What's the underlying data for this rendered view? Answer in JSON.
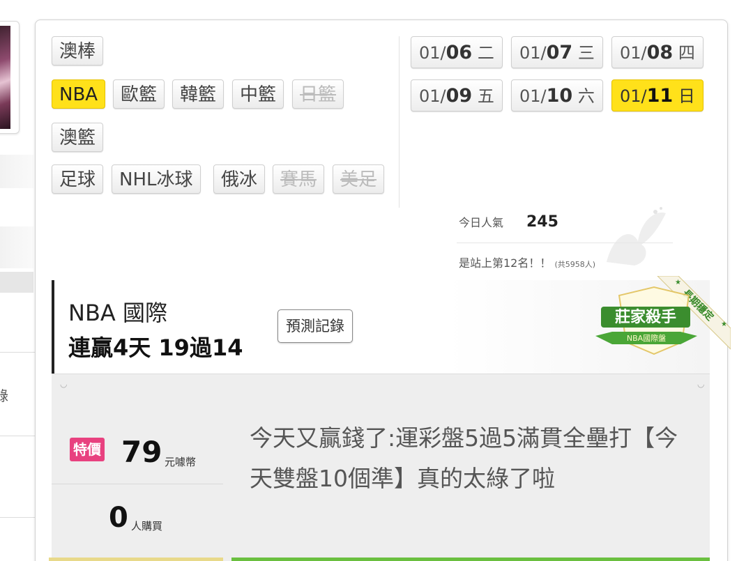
{
  "categories": {
    "row1": [
      {
        "label": "澳棒",
        "state": "normal"
      }
    ],
    "row2": [
      {
        "label": "NBA",
        "state": "active"
      },
      {
        "label": "歐籃",
        "state": "normal"
      },
      {
        "label": "韓籃",
        "state": "normal"
      },
      {
        "label": "中籃",
        "state": "normal"
      },
      {
        "label": "日籃",
        "state": "disabled"
      }
    ],
    "row3": [
      {
        "label": "澳籃",
        "state": "normal"
      }
    ],
    "row4": [
      {
        "label": "足球",
        "state": "normal"
      },
      {
        "label": "NHL冰球",
        "state": "normal"
      },
      {
        "label": "俄冰",
        "state": "normal"
      },
      {
        "label": "賽馬",
        "state": "disabled"
      },
      {
        "label": "美足",
        "state": "disabled"
      }
    ]
  },
  "dates": [
    {
      "month": "01/",
      "day": "06",
      "weekday": "二",
      "active": false
    },
    {
      "month": "01/",
      "day": "07",
      "weekday": "三",
      "active": false
    },
    {
      "month": "01/",
      "day": "08",
      "weekday": "四",
      "active": false
    },
    {
      "month": "01/",
      "day": "09",
      "weekday": "五",
      "active": false
    },
    {
      "month": "01/",
      "day": "10",
      "weekday": "六",
      "active": false
    },
    {
      "month": "01/",
      "day": "11",
      "weekday": "日",
      "active": true
    }
  ],
  "popularity": {
    "label": "今日人氣",
    "count": "245",
    "rank_text": "是站上第12名！！",
    "total_text": "(共5958人)"
  },
  "expert": {
    "league": "NBA 國際",
    "record": "連贏4天 19過14",
    "record_button": "預測記錄",
    "badge_title": "莊家殺手",
    "badge_sub": "NBA國際盤",
    "ribbon": "長期穩定"
  },
  "offer": {
    "special_label": "特價",
    "price": "79",
    "price_unit": "元噱幣",
    "buyers": "0",
    "buyers_unit": "人購買",
    "description": "今天又贏錢了:運彩盤5過5滿貫全壘打【今天雙盤10個準】真的太綠了啦"
  },
  "sidebar": {
    "fragment_char": "錄"
  },
  "colors": {
    "active": "#ffe11a",
    "special": "#e8417f",
    "accent_green": "#6abf3f"
  }
}
